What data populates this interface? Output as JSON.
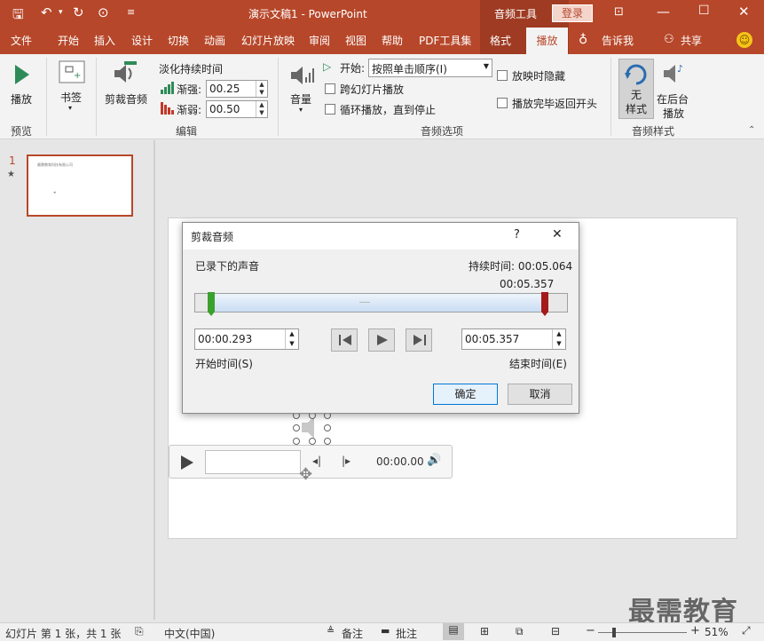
{
  "titlebar": {
    "doc_title": "演示文稿1  -  PowerPoint",
    "context_tab": "音频工具",
    "login": "登录"
  },
  "tabs": [
    "文件",
    "开始",
    "插入",
    "设计",
    "切换",
    "动画",
    "幻灯片放映",
    "审阅",
    "视图",
    "帮助",
    "PDF工具集",
    "格式",
    "播放"
  ],
  "tellme": "告诉我",
  "share": "共享",
  "ribbon": {
    "preview_play": "播放",
    "preview_group": "预览",
    "bookmark": "书签",
    "trim_audio": "剪裁音频",
    "fade_title": "淡化持续时间",
    "fade_in_label": "渐强:",
    "fade_in_value": "00.25",
    "fade_out_label": "渐弱:",
    "fade_out_value": "00.50",
    "edit_group": "编辑",
    "volume": "音量",
    "start_label": "开始:",
    "start_value": "按照单击顺序(I)",
    "cross_slides": "跨幻灯片播放",
    "loop": "循环播放，直到停止",
    "hide_during_show": "放映时隐藏",
    "rewind": "播放完毕返回开头",
    "audio_options_group": "音频选项",
    "no_style_1": "无",
    "no_style_2": "样式",
    "bg_play_1": "在后台",
    "bg_play_2": "播放",
    "audio_styles_group": "音频样式"
  },
  "thumbnail": {
    "number": "1",
    "star": "★",
    "text": "最需教育科技有限公司"
  },
  "player": {
    "time": "00:00.00"
  },
  "dialog": {
    "title": "剪裁音频",
    "help": "?",
    "close": "✕",
    "recorded": "已录下的声音",
    "duration": "持续时间: 00:05.064",
    "end_marker_time": "00:05.357",
    "start_time_value": "00:00.293",
    "end_time_value": "00:05.357",
    "start_time_label": "开始时间(S)",
    "end_time_label": "结束时间(E)",
    "ok": "确定",
    "cancel": "取消"
  },
  "watermark": "最需教育",
  "statusbar": {
    "slide_info": "幻灯片 第 1 张，共 1 张",
    "language": "中文(中国)",
    "notes": "备注",
    "comments": "批注",
    "zoom": "51%"
  },
  "colors": {
    "brand": "#b7472a",
    "accent_text": "#b7472a"
  }
}
